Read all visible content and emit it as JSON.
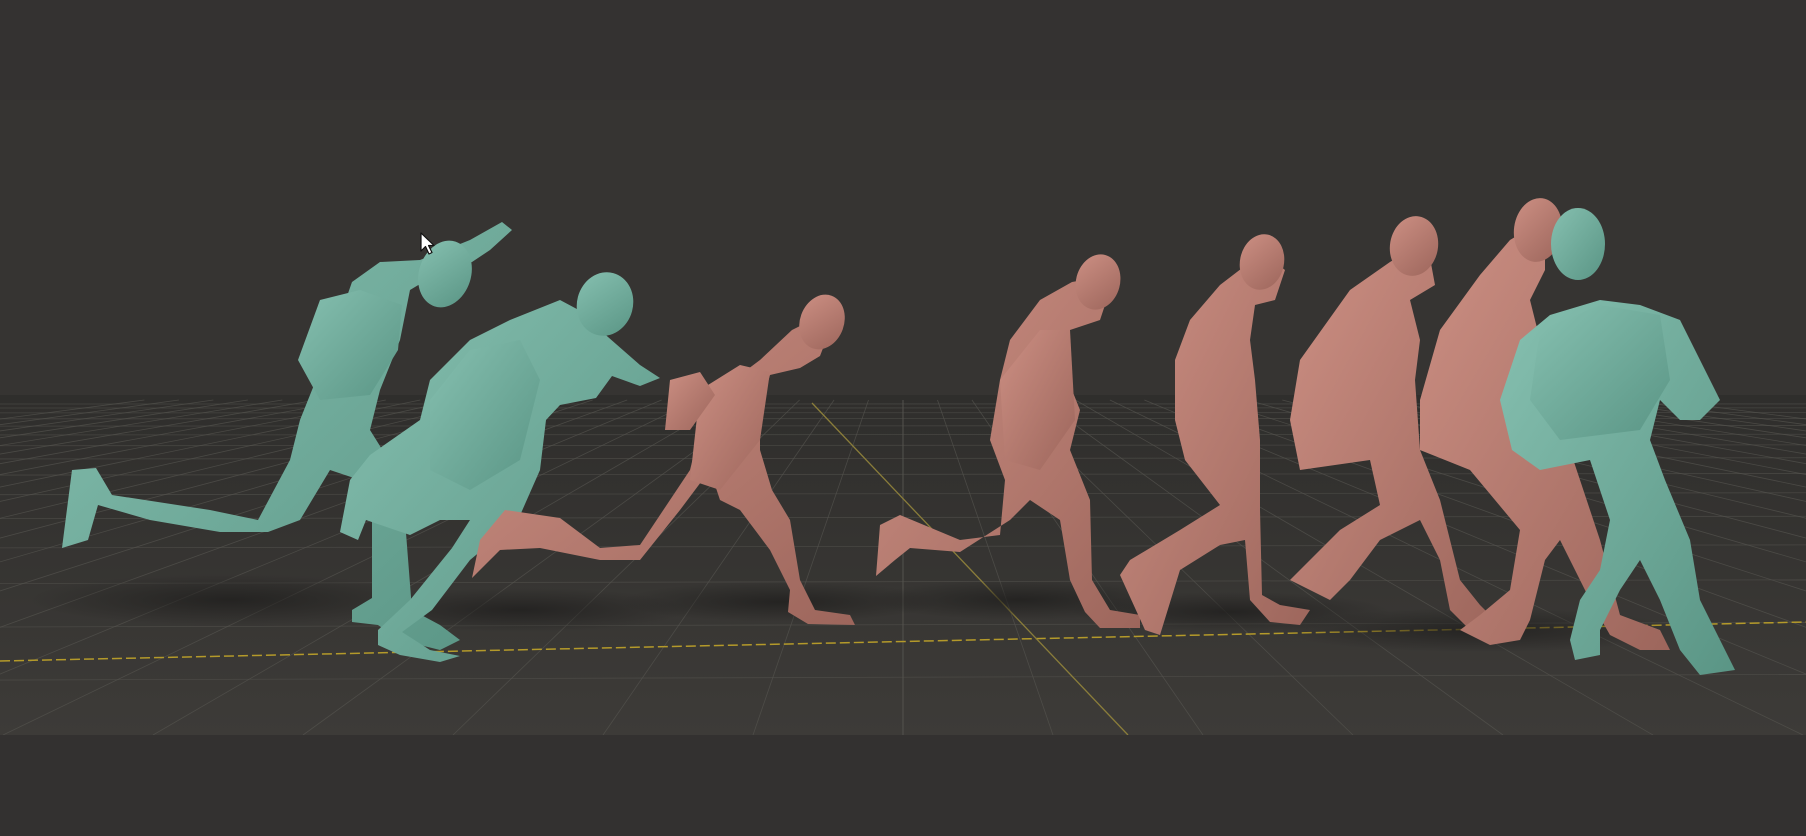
{
  "viewport": {
    "background_color": "#343231",
    "floor_color": "#3c3a37",
    "grid_color": "#55544f",
    "x_axis_color": "#b49a2a",
    "y_axis_color": "#8a7d3a",
    "teal_mesh_color": "#6fa99a",
    "salmon_mesh_color": "#b87b70",
    "figure_count": 9
  },
  "figures": [
    {
      "id": "figure-1",
      "material": "teal",
      "pose": "leaping-arm-raised"
    },
    {
      "id": "figure-2",
      "material": "teal",
      "pose": "running-hands-to-head"
    },
    {
      "id": "figure-3",
      "material": "salmon",
      "pose": "lunging-forward"
    },
    {
      "id": "figure-4",
      "material": "salmon",
      "pose": "running-crouched"
    },
    {
      "id": "figure-5",
      "material": "salmon",
      "pose": "walking-stride"
    },
    {
      "id": "figure-6",
      "material": "salmon",
      "pose": "walking-stride"
    },
    {
      "id": "figure-7",
      "material": "salmon",
      "pose": "walking-upright"
    },
    {
      "id": "figure-8",
      "material": "teal",
      "pose": "walking-forward"
    },
    {
      "id": "figure-9",
      "material": "salmon",
      "pose": "walking-forward-behind"
    }
  ],
  "cursor": {
    "icon": "mouse-pointer-icon"
  }
}
